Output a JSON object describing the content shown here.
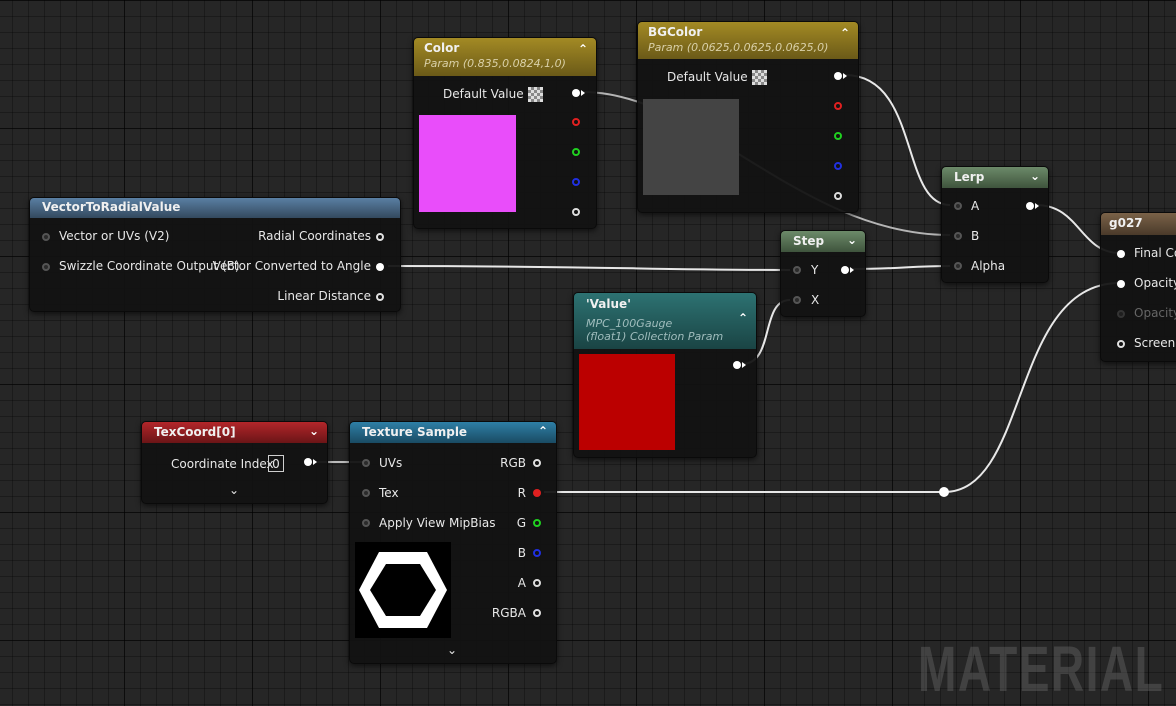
{
  "watermark": "MATERIAL",
  "nodes": {
    "color": {
      "title": "Color",
      "subtitle": "Param (0.835,0.0824,1,0)",
      "default_label": "Default Value",
      "swatch": "#e94dfa"
    },
    "bgcolor": {
      "title": "BGColor",
      "subtitle": "Param (0.0625,0.0625,0.0625,0)",
      "default_label": "Default Value",
      "swatch": "#444444"
    },
    "vector_radial": {
      "title": "VectorToRadialValue",
      "inputs": [
        "Vector or UVs (V2)",
        "Swizzle Coordinate Output (B)"
      ],
      "outputs": [
        "Radial Coordinates",
        "Vector Converted to Angle",
        "Linear Distance"
      ]
    },
    "lerp": {
      "title": "Lerp",
      "inputs": [
        "A",
        "B",
        "Alpha"
      ]
    },
    "step": {
      "title": "Step",
      "inputs": [
        "Y",
        "X"
      ]
    },
    "value": {
      "title": "'Value'",
      "subtitle_line1": "MPC_100Gauge",
      "subtitle_line2": "(float1) Collection Param",
      "swatch": "#bb0000"
    },
    "result": {
      "title": "g027",
      "inputs": [
        "Final Color",
        "Opacity",
        "Opacity Mask",
        "Screen Position"
      ]
    },
    "texcoord": {
      "title": "TexCoord[0]",
      "index_label": "Coordinate Index",
      "index_value": "0"
    },
    "texture": {
      "title": "Texture Sample",
      "inputs": [
        "UVs",
        "Tex",
        "Apply View MipBias"
      ],
      "outputs": [
        "RGB",
        "R",
        "G",
        "B",
        "A",
        "RGBA"
      ]
    }
  },
  "colors": {
    "color_hdr": "#a38a24",
    "bg_hdr": "#a38a24",
    "vec_hdr": "#5a7fa3",
    "lerp_hdr": "#6c8a69",
    "tex_hdr": "#2e7fa6",
    "texcoord_hdr": "#b3262a",
    "value_hdr": "#2d7272",
    "result_hdr": "#7a6248"
  }
}
